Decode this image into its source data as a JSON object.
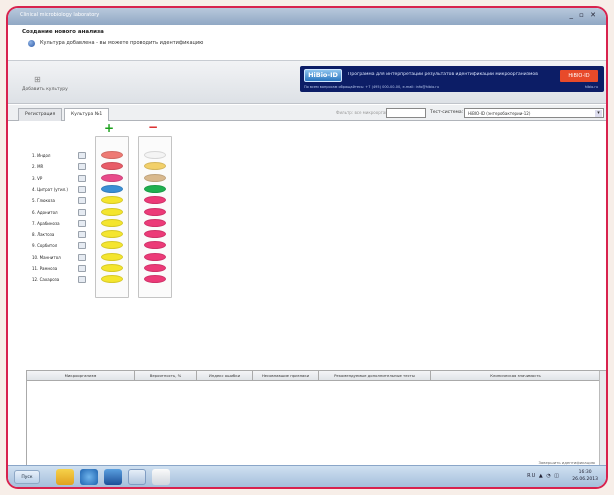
{
  "window": {
    "title": "Clinical microbiology laboratory",
    "controls": "_ ▫ ✕"
  },
  "header": {
    "title": "Создание нового анализа",
    "subtitle": "Культура добавлена - вы можете проводить идентификацию"
  },
  "toolbar": {
    "add_label": "Добавить культуру"
  },
  "banner": {
    "logo": "HiBio-ID",
    "title": "Программа для интерпретации результатов идентификации микроорганизмов",
    "sub": "По всем вопросам обращайтесь: +7 (495) 000-00-00, e-mail: info@hibio.ru",
    "badge": "HiBIO-ID",
    "link": "hibio.ru"
  },
  "tabs": [
    {
      "label": "Регистрация",
      "active": false
    },
    {
      "label": "Культура №1",
      "active": true
    }
  ],
  "filter_label": "Фильтр: все микроорганизмы",
  "test_system": {
    "label": "Тест-система:",
    "value": "HiBIO-ID (энтеробактерии-12)"
  },
  "signs": {
    "plus": "+",
    "minus": "−"
  },
  "tests": [
    {
      "label": "1. Индол",
      "pos_color": "#ee7a74",
      "neg_color": "#f4f4f4"
    },
    {
      "label": "2. МR",
      "pos_color": "#e85c68",
      "neg_color": "#f2d06a"
    },
    {
      "label": "3. VP",
      "pos_color": "#e84a8a",
      "neg_color": "#d9b98e"
    },
    {
      "label": "4. Цитрат (утил.)",
      "pos_color": "#3a8fd6",
      "neg_color": "#1fb050"
    },
    {
      "label": "5. Глюкоза",
      "pos_color": "#f4e52e",
      "neg_color": "#ec3a78"
    },
    {
      "label": "6. Адонитол",
      "pos_color": "#f4e52e",
      "neg_color": "#ec3a78"
    },
    {
      "label": "7. Арабиноза",
      "pos_color": "#f4e52e",
      "neg_color": "#ec3a78"
    },
    {
      "label": "8. Лактоза",
      "pos_color": "#f4e52e",
      "neg_color": "#ec3a78"
    },
    {
      "label": "9. Сорбитол",
      "pos_color": "#f4e52e",
      "neg_color": "#ec3a78"
    },
    {
      "label": "10. Маннитол",
      "pos_color": "#f4e52e",
      "neg_color": "#ec3a78"
    },
    {
      "label": "11. Рамноза",
      "pos_color": "#f4e52e",
      "neg_color": "#ec3a78"
    },
    {
      "label": "12. Сахароза",
      "pos_color": "#f4e52e",
      "neg_color": "#ec3a78"
    }
  ],
  "grid": {
    "columns": [
      "Микроорганизм",
      "Вероятность, %",
      "Индекс ошибки",
      "Несовпавшие признаки",
      "Рекомендуемые дополнительные тесты",
      "Клиническая значимость"
    ],
    "footer": "Завершить идентификацию"
  },
  "taskbar": {
    "start": "Пуск",
    "tray": "RU ▲ ◔ ◫",
    "time": "16:30",
    "date": "26.06.2013"
  }
}
